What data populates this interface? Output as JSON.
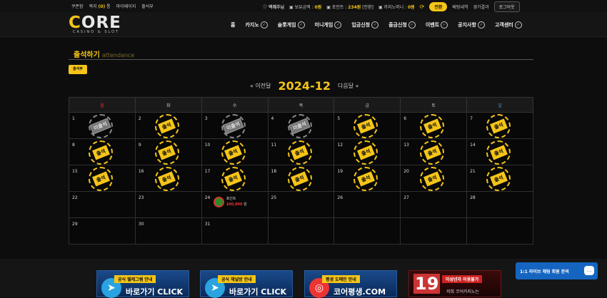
{
  "topbar": {
    "coupon": "쿠폰함",
    "message": "쪽지",
    "message_count": "(0)",
    "message_unit": "통",
    "mypage": "마이페이지",
    "attendance": "출석부",
    "user": "백혜주님",
    "balance_label": "보유금액 :",
    "balance_value": "0원",
    "points_label": "포인트 :",
    "points_value": "234원",
    "points_convert": "[전환]",
    "casino_money_label": "카지노머니 :",
    "casino_money_value": "0원",
    "refresh_icon": "refresh-icon",
    "charge": "전환",
    "bet_history": "배팅내역",
    "game_results": "경기결과",
    "logout": "로그아웃"
  },
  "logo": {
    "c": "C",
    "ore": "ORE",
    "sub": "CASINO & SLOT"
  },
  "nav": [
    {
      "label": "홈",
      "dropdown": false
    },
    {
      "label": "카지노",
      "dropdown": true
    },
    {
      "label": "슬롯게임",
      "dropdown": true
    },
    {
      "label": "미니게임",
      "dropdown": true
    },
    {
      "label": "입금신청",
      "dropdown": true
    },
    {
      "label": "출금신청",
      "dropdown": true
    },
    {
      "label": "이벤트",
      "dropdown": true
    },
    {
      "label": "공지사항",
      "dropdown": true
    },
    {
      "label": "고객센터",
      "dropdown": true
    }
  ],
  "page": {
    "title": "출석하기",
    "title_en": "attendance",
    "attend_button": "출석부",
    "prev_month": "« 이전달",
    "month": "2024-12",
    "next_month": "다음달 »"
  },
  "calendar": {
    "weekdays": [
      "월",
      "화",
      "수",
      "목",
      "금",
      "토",
      "일"
    ],
    "colors": {
      "accent": "#f5c518",
      "sunday": "#e22233",
      "saturday": "#4499dd",
      "missed": "#777777"
    },
    "stamp_attended": "출석",
    "stamp_missed": "미출석",
    "prize_label": "포인트",
    "prize_amount": "100,000",
    "prize_unit": "원",
    "weeks": [
      [
        {
          "d": "1",
          "s": "missed"
        },
        {
          "d": "2",
          "s": "attended"
        },
        {
          "d": "3",
          "s": "missed"
        },
        {
          "d": "4",
          "s": "missed"
        },
        {
          "d": "5",
          "s": "attended"
        },
        {
          "d": "6",
          "s": "attended"
        },
        {
          "d": "7",
          "s": "attended"
        }
      ],
      [
        {
          "d": "8",
          "s": "attended"
        },
        {
          "d": "9",
          "s": "attended"
        },
        {
          "d": "10",
          "s": "attended"
        },
        {
          "d": "11",
          "s": "attended"
        },
        {
          "d": "12",
          "s": "attended"
        },
        {
          "d": "13",
          "s": "attended"
        },
        {
          "d": "14",
          "s": "attended"
        }
      ],
      [
        {
          "d": "15",
          "s": "attended"
        },
        {
          "d": "16",
          "s": "attended"
        },
        {
          "d": "17",
          "s": "attended"
        },
        {
          "d": "18",
          "s": "attended"
        },
        {
          "d": "19",
          "s": "attended"
        },
        {
          "d": "20",
          "s": "attended"
        },
        {
          "d": "21",
          "s": "attended"
        }
      ],
      [
        {
          "d": "22",
          "s": ""
        },
        {
          "d": "23",
          "s": ""
        },
        {
          "d": "24",
          "s": "prize"
        },
        {
          "d": "25",
          "s": ""
        },
        {
          "d": "26",
          "s": ""
        },
        {
          "d": "27",
          "s": ""
        },
        {
          "d": "28",
          "s": ""
        }
      ],
      [
        {
          "d": "29",
          "s": ""
        },
        {
          "d": "30",
          "s": ""
        },
        {
          "d": "31",
          "s": ""
        },
        {
          "d": "",
          "s": ""
        },
        {
          "d": "",
          "s": ""
        },
        {
          "d": "",
          "s": ""
        },
        {
          "d": "",
          "s": ""
        }
      ]
    ]
  },
  "banners": [
    {
      "top": "공식 텔레그램 안내",
      "main": "바로가기 CLICK",
      "icon": "telegram-icon"
    },
    {
      "top": "공식 채널방 안내",
      "main": "바로가기 CLICK",
      "icon": "telegram-icon"
    },
    {
      "top": "평생 도메인 안내",
      "main": "코어평생.COM",
      "icon": "chrome-icon"
    },
    {
      "top": "미성년자 이용불가",
      "main": "저희 코어카지노는",
      "num": "19",
      "icon": "age-restriction-icon"
    }
  ],
  "chat": {
    "label": "1:1 라이브 채팅 회원 문의",
    "icon": "chat-icon"
  }
}
